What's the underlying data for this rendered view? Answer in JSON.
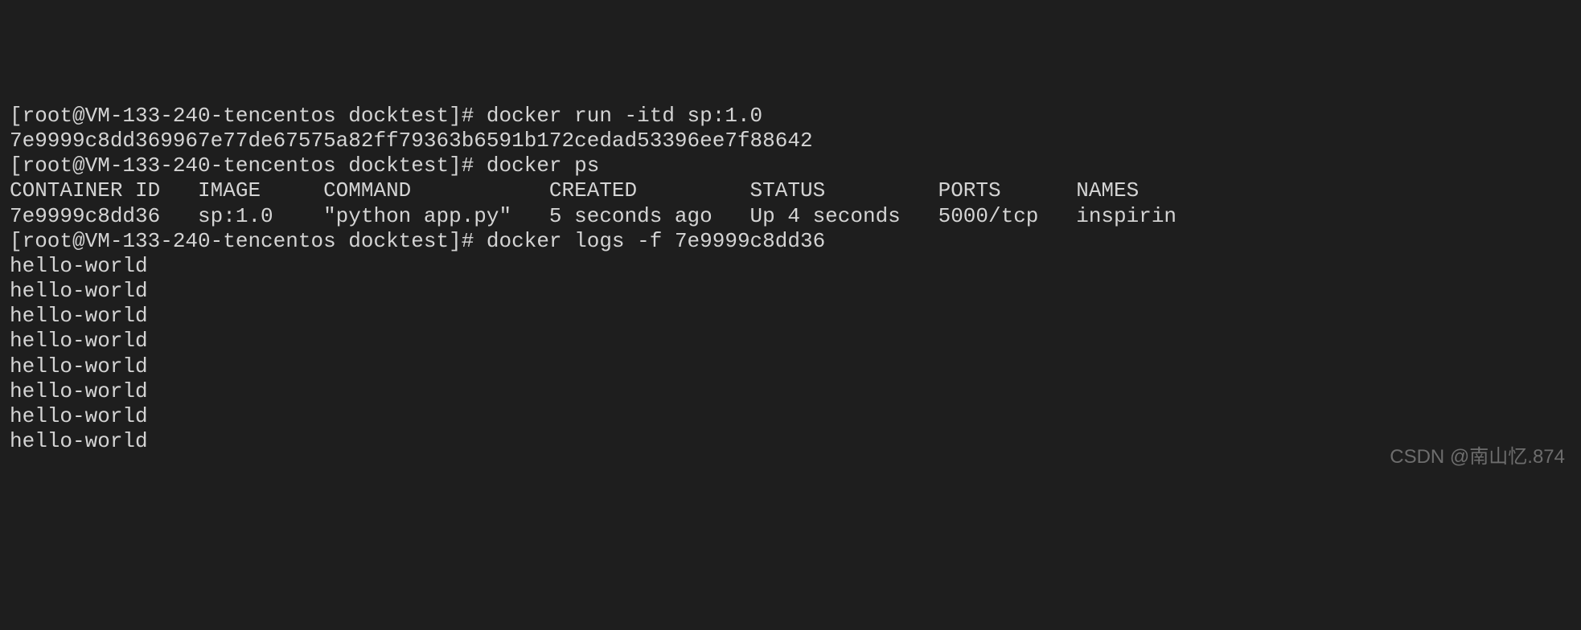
{
  "terminal": {
    "lines": [
      {
        "type": "command",
        "prompt": "[root@VM-133-240-tencentos docktest]# ",
        "cmd": "docker run -itd sp:1.0"
      },
      {
        "type": "output",
        "text": "7e9999c8dd369967e77de67575a82ff79363b6591b172cedad53396ee7f88642"
      },
      {
        "type": "command",
        "prompt": "[root@VM-133-240-tencentos docktest]# ",
        "cmd": "docker ps"
      },
      {
        "type": "output",
        "text": "CONTAINER ID   IMAGE     COMMAND           CREATED         STATUS         PORTS      NAMES"
      },
      {
        "type": "output",
        "text": "7e9999c8dd36   sp:1.0    \"python app.py\"   5 seconds ago   Up 4 seconds   5000/tcp   inspirin"
      },
      {
        "type": "command",
        "prompt": "[root@VM-133-240-tencentos docktest]# ",
        "cmd": "docker logs -f 7e9999c8dd36"
      },
      {
        "type": "output",
        "text": "hello-world"
      },
      {
        "type": "output",
        "text": "hello-world"
      },
      {
        "type": "output",
        "text": "hello-world"
      },
      {
        "type": "output",
        "text": "hello-world"
      },
      {
        "type": "output",
        "text": "hello-world"
      },
      {
        "type": "output",
        "text": "hello-world"
      },
      {
        "type": "output",
        "text": "hello-world"
      },
      {
        "type": "output",
        "text": "hello-world"
      }
    ]
  },
  "watermark": "CSDN @南山忆.874"
}
